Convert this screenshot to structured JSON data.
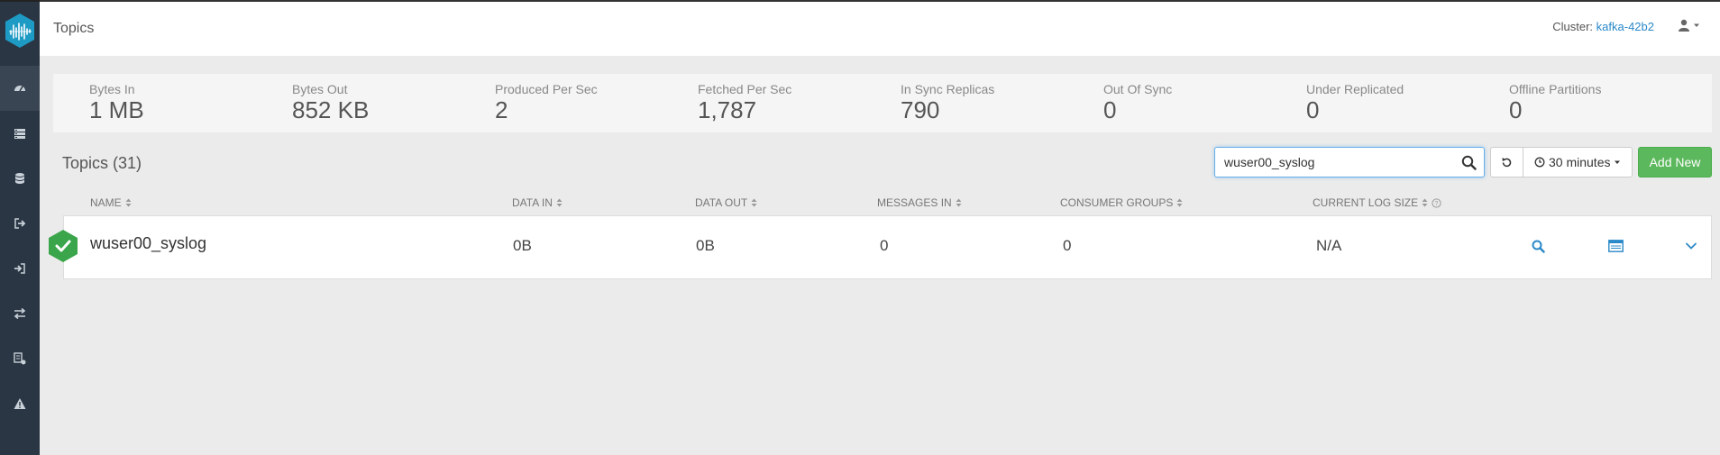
{
  "sidebar": {
    "items": [
      {
        "icon": "dashboard-icon",
        "active": true
      },
      {
        "icon": "brokers-icon"
      },
      {
        "icon": "database-icon"
      },
      {
        "icon": "sign-out-icon"
      },
      {
        "icon": "sign-in-icon"
      },
      {
        "icon": "exchange-icon"
      },
      {
        "icon": "schema-icon"
      },
      {
        "icon": "warning-icon"
      }
    ]
  },
  "header": {
    "title": "Topics",
    "cluster_label": "Cluster:",
    "cluster_name": "kafka-42b2"
  },
  "stats": [
    {
      "label": "Bytes In",
      "value": "1 MB"
    },
    {
      "label": "Bytes Out",
      "value": "852 KB"
    },
    {
      "label": "Produced Per Sec",
      "value": "2"
    },
    {
      "label": "Fetched Per Sec",
      "value": "1,787"
    },
    {
      "label": "In Sync Replicas",
      "value": "790"
    },
    {
      "label": "Out Of Sync",
      "value": "0"
    },
    {
      "label": "Under Replicated",
      "value": "0"
    },
    {
      "label": "Offline Partitions",
      "value": "0"
    }
  ],
  "toolbar": {
    "topics_title": "Topics (31)",
    "search_value": "wuser00_syslog",
    "time_range": "30 minutes",
    "add_label": "Add New"
  },
  "table": {
    "columns": [
      "NAME",
      "DATA IN",
      "DATA OUT",
      "MESSAGES IN",
      "CONSUMER GROUPS",
      "CURRENT LOG SIZE"
    ],
    "rows": [
      {
        "name": "wuser00_syslog",
        "data_in": "0B",
        "data_out": "0B",
        "messages_in": "0",
        "consumer_groups": "0",
        "log_size": "N/A",
        "status": "healthy"
      }
    ]
  },
  "colors": {
    "sidebar_bg": "#2a3644",
    "accent": "#2a89c9",
    "success": "#5cb85c",
    "status_green": "#3aa54a"
  }
}
